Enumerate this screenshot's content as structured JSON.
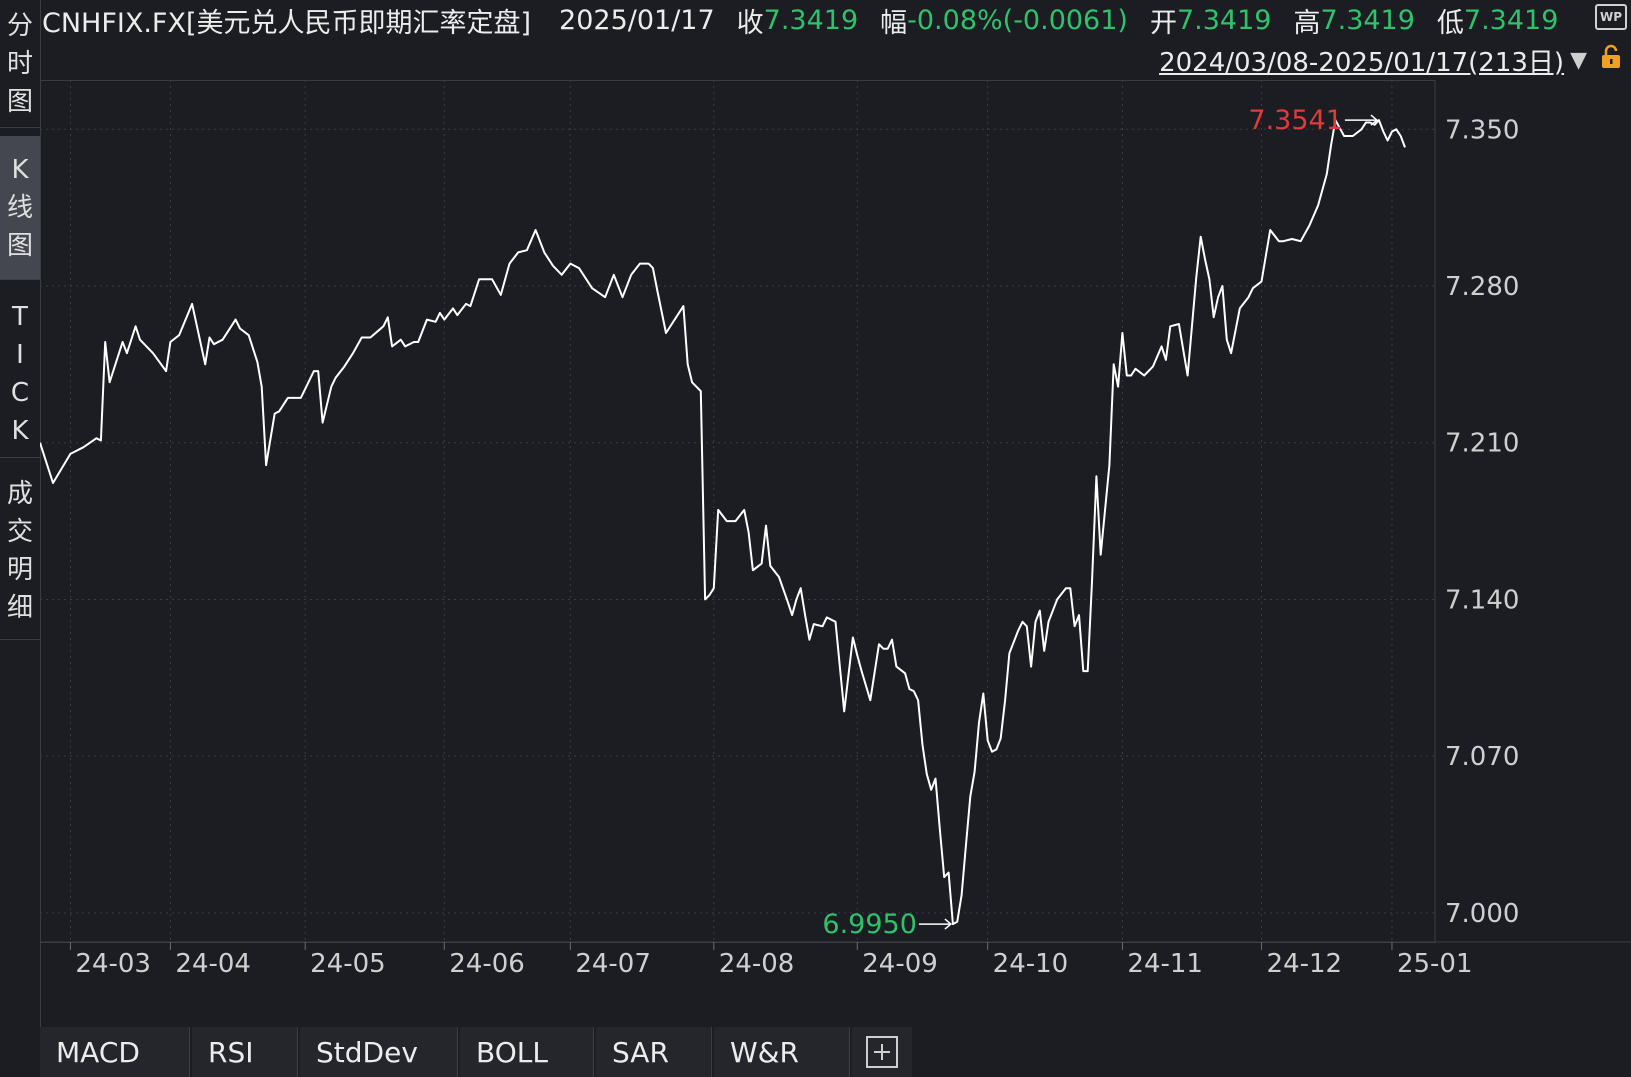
{
  "sidebar": {
    "tabs": [
      {
        "id": "fenshi",
        "chars": [
          "分",
          "时",
          "图"
        ],
        "active": false
      },
      {
        "id": "kline",
        "chars": [
          "K",
          "线",
          "图"
        ],
        "active": true
      },
      {
        "id": "tick",
        "chars": [
          "T",
          "I",
          "C",
          "K"
        ],
        "active": false
      },
      {
        "id": "deals",
        "chars": [
          "成",
          "交",
          "明",
          "细"
        ],
        "active": false
      }
    ]
  },
  "header": {
    "title": "CNHFIX.FX[美元兑人民币即期汇率定盘]",
    "date": "2025/01/17",
    "close_label": "收",
    "close_value": "7.3419",
    "change_label": "幅",
    "change_value": "-0.08%(-0.0061)",
    "open_label": "开",
    "open_value": "7.3419",
    "high_label": "高",
    "high_value": "7.3419",
    "low_label": "低",
    "low_value": "7.3419",
    "range": "2024/03/08-2025/01/17(213日)",
    "wp_badge": "WP"
  },
  "colors": {
    "background": "#1b1d22",
    "line": "#ffffff",
    "grid": "#3a3d44",
    "up": "#e03b3b",
    "down": "#2ec36b",
    "text": "#e6e6e6"
  },
  "icons": {
    "range_dropdown": "▼",
    "lock": "lock-icon",
    "add": "plus-box-icon"
  },
  "chart_data": {
    "type": "line",
    "y_ticks": [
      "7.350",
      "7.280",
      "7.210",
      "7.140",
      "7.070",
      "7.000"
    ],
    "ylim": [
      6.987,
      7.372
    ],
    "x_tick_labels": [
      "24-03",
      "24-04",
      "24-05",
      "24-06",
      "24-07",
      "24-08",
      "24-09",
      "24-10",
      "24-11",
      "24-12",
      "25-01"
    ],
    "x_tick_positions": [
      7,
      30,
      61,
      93,
      122,
      155,
      188,
      218,
      249,
      281,
      311
    ],
    "max_label": "7.3541",
    "min_label": "6.9950",
    "max_index": 308,
    "min_index": 210,
    "n_days": 213,
    "points": [
      [
        0,
        7.21
      ],
      [
        3,
        7.192
      ],
      [
        7,
        7.205
      ],
      [
        10,
        7.208
      ],
      [
        13,
        7.212
      ],
      [
        14,
        7.211
      ],
      [
        15,
        7.255
      ],
      [
        16,
        7.237
      ],
      [
        19,
        7.255
      ],
      [
        20,
        7.25
      ],
      [
        22,
        7.262
      ],
      [
        23,
        7.256
      ],
      [
        26,
        7.25
      ],
      [
        29,
        7.242
      ],
      [
        30,
        7.255
      ],
      [
        32,
        7.258
      ],
      [
        35,
        7.272
      ],
      [
        38,
        7.245
      ],
      [
        39,
        7.257
      ],
      [
        40,
        7.254
      ],
      [
        42,
        7.256
      ],
      [
        45,
        7.265
      ],
      [
        46,
        7.261
      ],
      [
        48,
        7.258
      ],
      [
        50,
        7.246
      ],
      [
        51,
        7.235
      ],
      [
        52,
        7.2
      ],
      [
        54,
        7.223
      ],
      [
        55,
        7.224
      ],
      [
        57,
        7.23
      ],
      [
        60,
        7.23
      ],
      [
        63,
        7.242
      ],
      [
        64,
        7.242
      ],
      [
        65,
        7.219
      ],
      [
        67,
        7.235
      ],
      [
        68,
        7.239
      ],
      [
        70,
        7.244
      ],
      [
        72,
        7.25
      ],
      [
        74,
        7.257
      ],
      [
        76,
        7.257
      ],
      [
        79,
        7.262
      ],
      [
        80,
        7.266
      ],
      [
        81,
        7.253
      ],
      [
        83,
        7.256
      ],
      [
        84,
        7.253
      ],
      [
        86,
        7.255
      ],
      [
        87,
        7.255
      ],
      [
        89,
        7.265
      ],
      [
        91,
        7.264
      ],
      [
        92,
        7.268
      ],
      [
        93,
        7.265
      ],
      [
        95,
        7.27
      ],
      [
        96,
        7.267
      ],
      [
        98,
        7.272
      ],
      [
        99,
        7.271
      ],
      [
        101,
        7.283
      ],
      [
        104,
        7.283
      ],
      [
        106,
        7.276
      ],
      [
        108,
        7.29
      ],
      [
        110,
        7.295
      ],
      [
        112,
        7.296
      ],
      [
        114,
        7.305
      ],
      [
        116,
        7.295
      ],
      [
        118,
        7.289
      ],
      [
        120,
        7.285
      ],
      [
        122,
        7.29
      ],
      [
        124,
        7.288
      ],
      [
        127,
        7.279
      ],
      [
        130,
        7.275
      ],
      [
        132,
        7.285
      ],
      [
        134,
        7.275
      ],
      [
        136,
        7.285
      ],
      [
        138,
        7.29
      ],
      [
        140,
        7.29
      ],
      [
        141,
        7.288
      ],
      [
        142,
        7.278
      ],
      [
        144,
        7.259
      ],
      [
        148,
        7.271
      ],
      [
        149,
        7.245
      ],
      [
        150,
        7.237
      ],
      [
        152,
        7.233
      ],
      [
        153,
        7.14
      ],
      [
        154,
        7.142
      ],
      [
        155,
        7.145
      ],
      [
        156,
        7.18
      ],
      [
        158,
        7.175
      ],
      [
        160,
        7.175
      ],
      [
        162,
        7.18
      ],
      [
        163,
        7.17
      ],
      [
        164,
        7.153
      ],
      [
        166,
        7.156
      ],
      [
        167,
        7.173
      ],
      [
        168,
        7.155
      ],
      [
        170,
        7.15
      ],
      [
        172,
        7.139
      ],
      [
        173,
        7.133
      ],
      [
        174,
        7.14
      ],
      [
        175,
        7.145
      ],
      [
        176,
        7.133
      ],
      [
        177,
        7.122
      ],
      [
        178,
        7.129
      ],
      [
        180,
        7.128
      ],
      [
        181,
        7.132
      ],
      [
        183,
        7.13
      ],
      [
        185,
        7.09
      ],
      [
        187,
        7.123
      ],
      [
        188,
        7.115
      ],
      [
        189,
        7.108
      ],
      [
        191,
        7.095
      ],
      [
        193,
        7.12
      ],
      [
        194,
        7.118
      ],
      [
        195,
        7.118
      ],
      [
        196,
        7.122
      ],
      [
        197,
        7.11
      ],
      [
        199,
        7.107
      ],
      [
        200,
        7.1
      ],
      [
        201,
        7.099
      ],
      [
        202,
        7.095
      ],
      [
        203,
        7.075
      ],
      [
        204,
        7.062
      ],
      [
        205,
        7.055
      ],
      [
        206,
        7.06
      ],
      [
        207,
        7.037
      ],
      [
        208,
        7.016
      ],
      [
        209,
        7.018
      ],
      [
        210,
        6.995
      ],
      [
        211,
        6.996
      ],
      [
        212,
        7.008
      ],
      [
        213,
        7.03
      ],
      [
        214,
        7.052
      ],
      [
        215,
        7.063
      ],
      [
        216,
        7.085
      ],
      [
        217,
        7.098
      ],
      [
        218,
        7.077
      ],
      [
        219,
        7.072
      ],
      [
        220,
        7.073
      ],
      [
        221,
        7.078
      ],
      [
        222,
        7.095
      ],
      [
        223,
        7.116
      ],
      [
        225,
        7.126
      ],
      [
        226,
        7.13
      ],
      [
        227,
        7.128
      ],
      [
        228,
        7.11
      ],
      [
        229,
        7.13
      ],
      [
        230,
        7.135
      ],
      [
        231,
        7.117
      ],
      [
        232,
        7.13
      ],
      [
        234,
        7.14
      ],
      [
        236,
        7.145
      ],
      [
        237,
        7.145
      ],
      [
        238,
        7.128
      ],
      [
        239,
        7.133
      ],
      [
        240,
        7.108
      ],
      [
        241,
        7.108
      ],
      [
        242,
        7.148
      ],
      [
        243,
        7.195
      ],
      [
        244,
        7.16
      ],
      [
        246,
        7.2
      ],
      [
        247,
        7.245
      ],
      [
        248,
        7.235
      ],
      [
        249,
        7.259
      ],
      [
        250,
        7.24
      ],
      [
        251,
        7.24
      ],
      [
        252,
        7.243
      ],
      [
        254,
        7.24
      ],
      [
        256,
        7.244
      ],
      [
        258,
        7.253
      ],
      [
        259,
        7.247
      ],
      [
        260,
        7.262
      ],
      [
        262,
        7.263
      ],
      [
        264,
        7.24
      ],
      [
        266,
        7.284
      ],
      [
        267,
        7.302
      ],
      [
        268,
        7.292
      ],
      [
        269,
        7.283
      ],
      [
        270,
        7.266
      ],
      [
        271,
        7.275
      ],
      [
        272,
        7.28
      ],
      [
        273,
        7.256
      ],
      [
        274,
        7.25
      ],
      [
        276,
        7.27
      ],
      [
        278,
        7.275
      ],
      [
        279,
        7.279
      ],
      [
        281,
        7.282
      ],
      [
        283,
        7.305
      ],
      [
        285,
        7.3
      ],
      [
        286,
        7.3
      ],
      [
        288,
        7.301
      ],
      [
        290,
        7.3
      ],
      [
        292,
        7.307
      ],
      [
        294,
        7.316
      ],
      [
        296,
        7.33
      ],
      [
        297,
        7.343
      ],
      [
        298,
        7.3541
      ],
      [
        300,
        7.347
      ],
      [
        302,
        7.347
      ],
      [
        304,
        7.35
      ],
      [
        305,
        7.353
      ],
      [
        306,
        7.353
      ],
      [
        307,
        7.352
      ],
      [
        308,
        7.3541
      ],
      [
        309,
        7.349
      ],
      [
        310,
        7.345
      ],
      [
        311,
        7.349
      ],
      [
        312,
        7.35
      ],
      [
        313,
        7.347
      ],
      [
        314,
        7.3419
      ]
    ]
  },
  "indicator_tabs": [
    "MACD",
    "RSI",
    "StdDev",
    "BOLL",
    "SAR",
    "W&R"
  ]
}
